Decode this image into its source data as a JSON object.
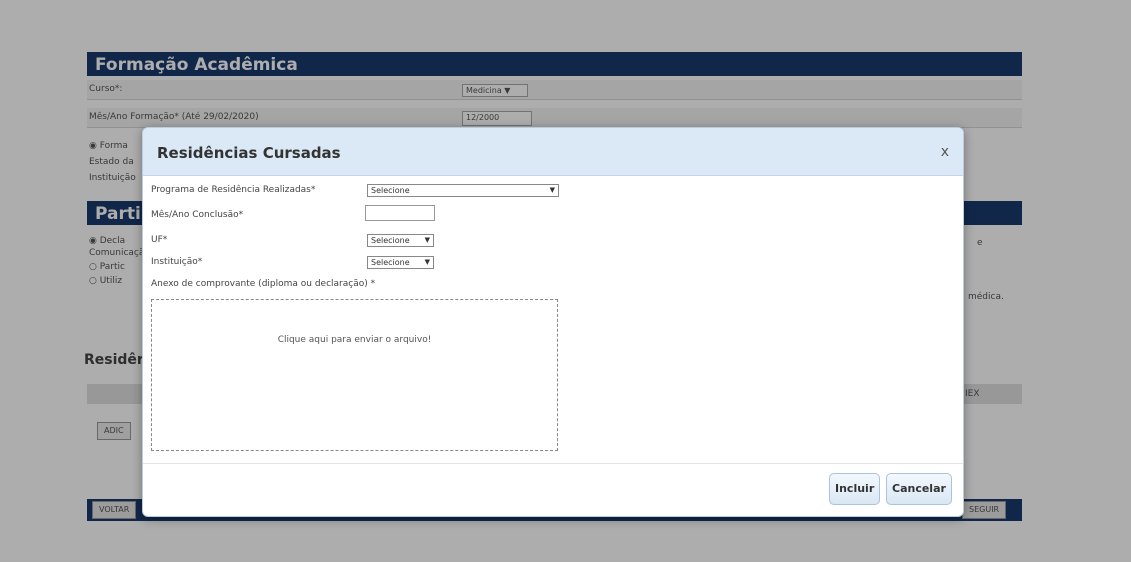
{
  "background": {
    "section1_title": "Formação Acadêmica",
    "curso_label": "Curso*:",
    "curso_value": "Medicina ▼",
    "mes_ano_label": "Mês/Ano Formação* (Até 29/02/2020)",
    "mes_ano_value": "12/2000",
    "radio_row": "◉ Forma",
    "estado_label": "Estado da",
    "instituicao_label": "Instituição",
    "section2_title": "Parti",
    "declaro_text": "◉ Decla",
    "comunic_text": "Comunicação",
    "partic_text": "○ Partic",
    "utiliz_text": "○ Utiliz",
    "right_e": "e",
    "right_medica": "médica.",
    "residencias_heading": "Residêr",
    "adic_btn": "ADIC",
    "right_col": "IEX",
    "voltar_btn": "VOLTAR",
    "seguir_btn": "SEGUIR"
  },
  "modal": {
    "title": "Residências Cursadas",
    "close": "x",
    "programa_label": "Programa de Residência Realizadas*",
    "programa_value": "Selecione",
    "mes_ano_conclusao_label": "Mês/Ano Conclusão*",
    "uf_label": "UF*",
    "uf_value": "Selecione",
    "instituicao_label": "Instituição*",
    "instituicao_value": "Selecione",
    "anexo_label": "Anexo de comprovante (diploma ou declaração) *",
    "dropzone_text": "Clique aqui para enviar o arquivo!",
    "incluir_label": "Incluir",
    "cancelar_label": "Cancelar"
  },
  "colors": {
    "header_blue": "#1a3a6e",
    "modal_header": "#dbe9f6",
    "button_border": "#a9c4de"
  }
}
